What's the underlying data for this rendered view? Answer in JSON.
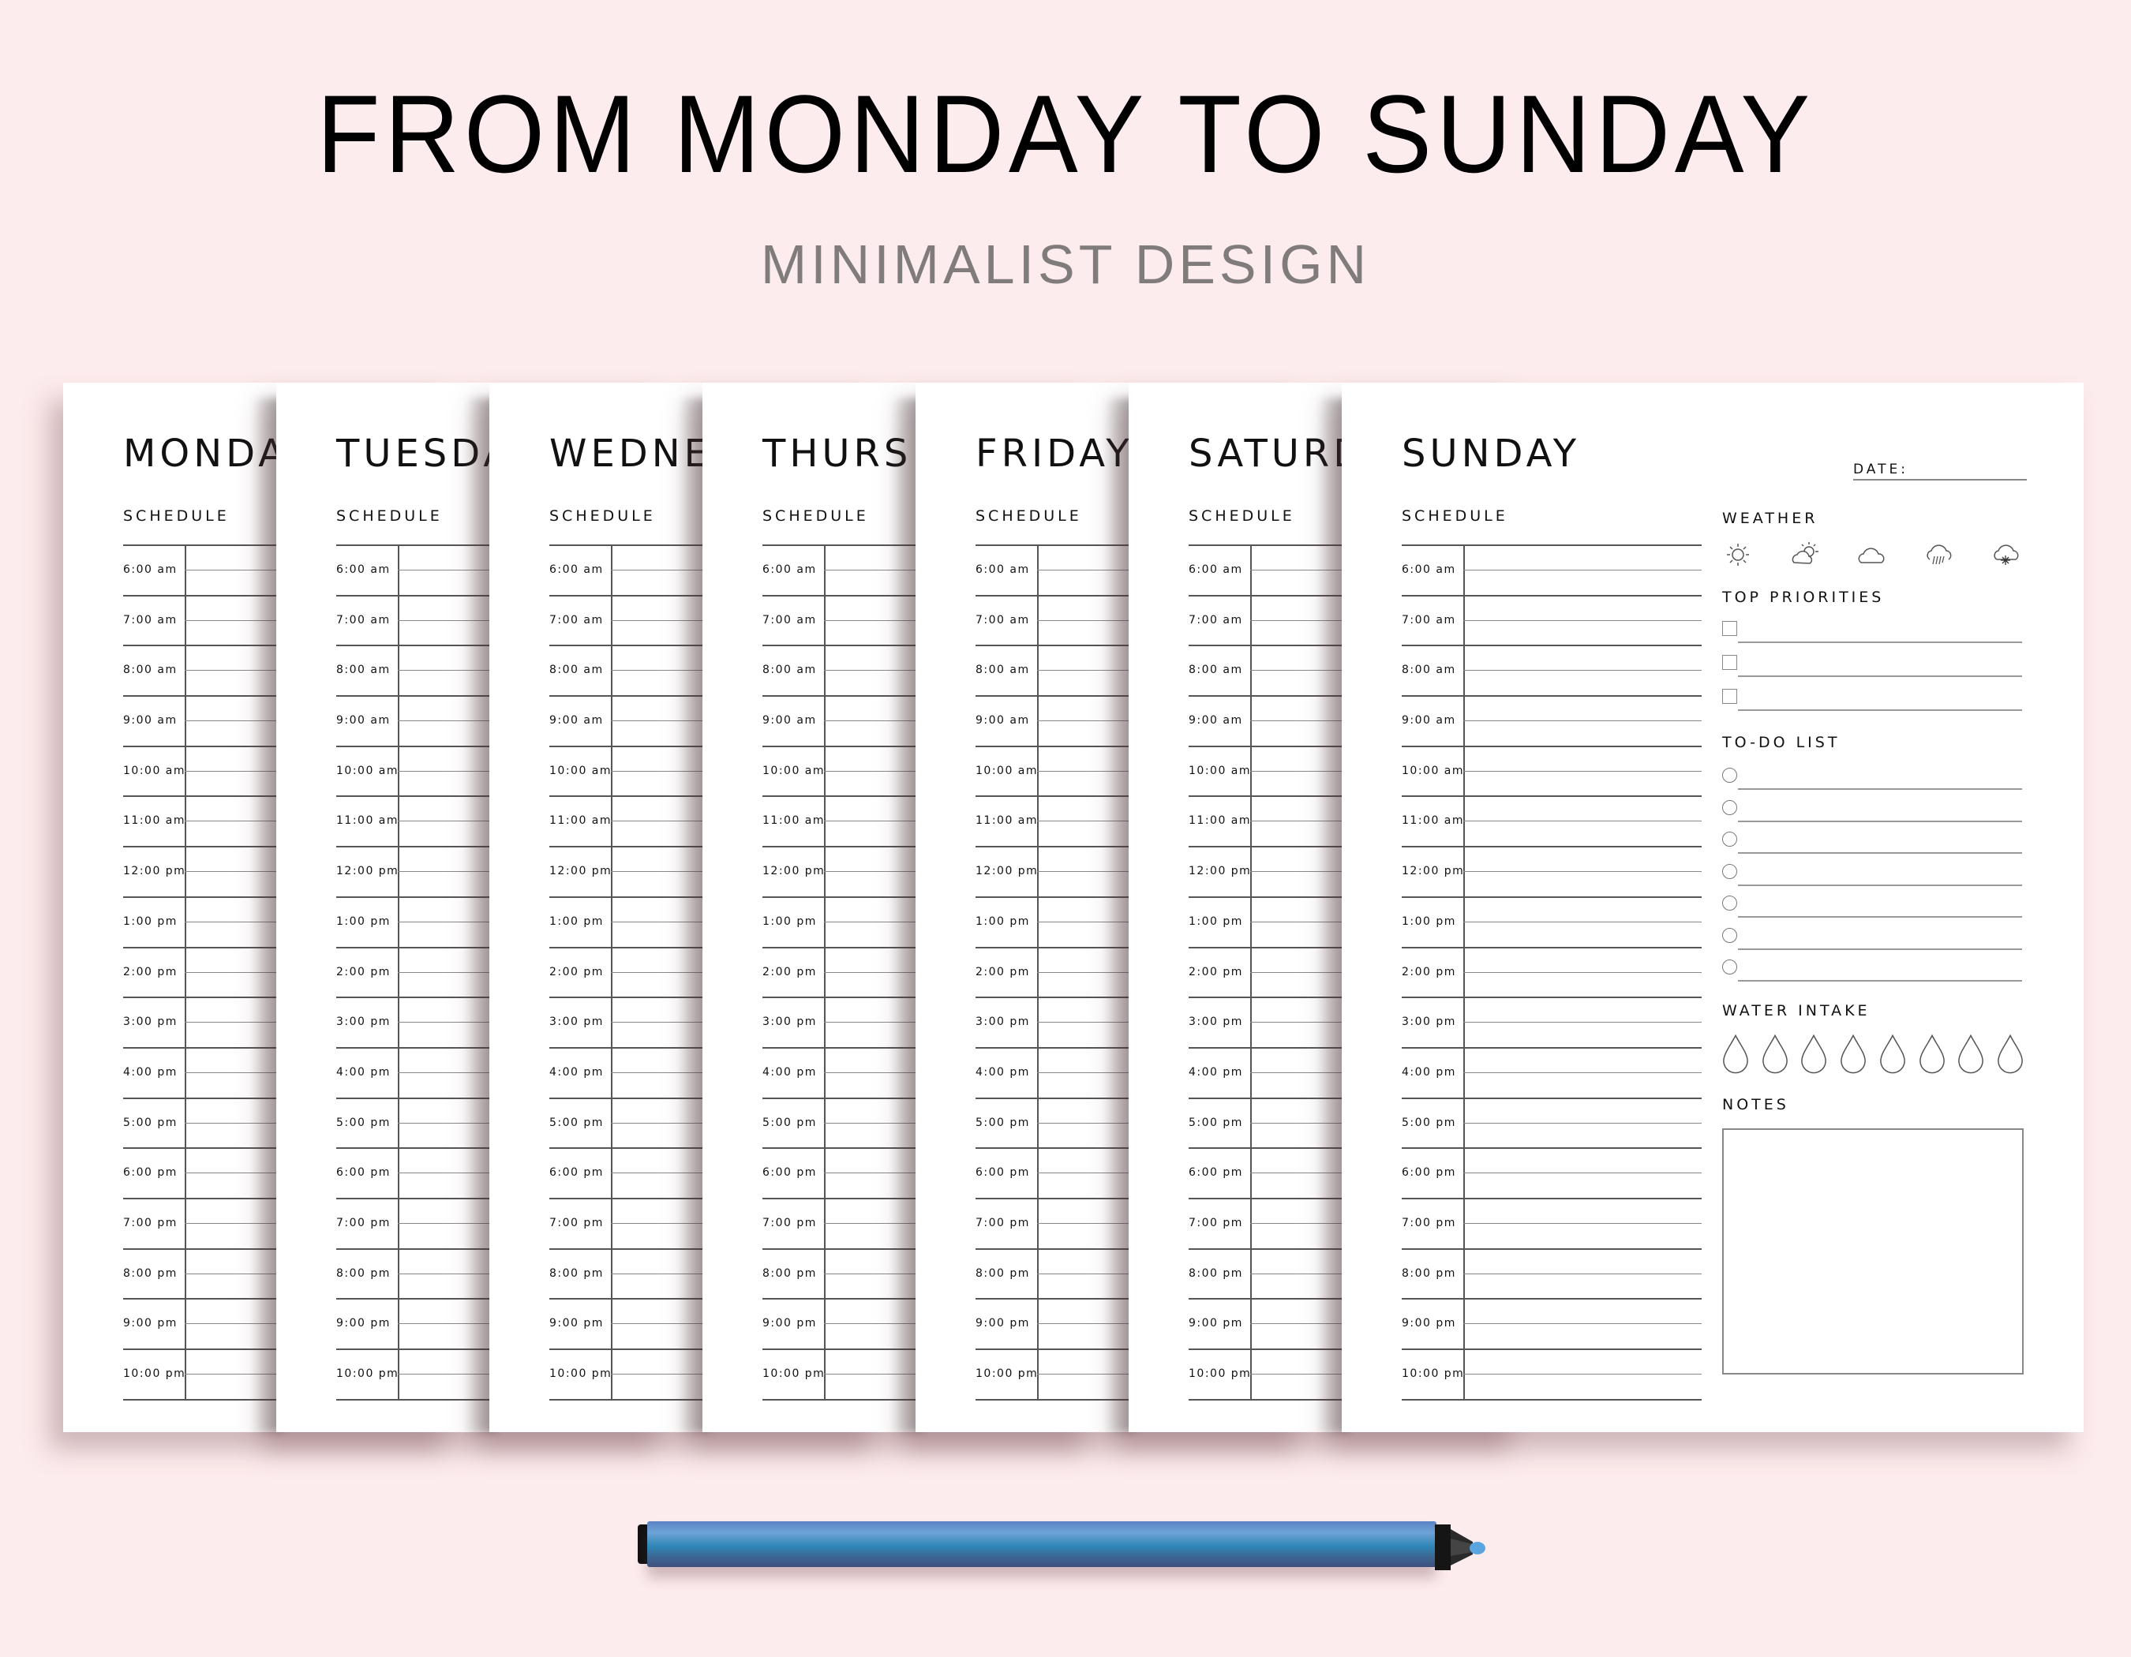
{
  "header": {
    "title": "FROM MONDAY TO SUNDAY",
    "subtitle": "MINIMALIST DESIGN"
  },
  "colors": {
    "background": "#fdeced",
    "page": "#ffffff",
    "subtitle": "#807c7c",
    "pen_body": "#4a86c0"
  },
  "planner": {
    "schedule_label": "SCHEDULE",
    "times": [
      "6:00 am",
      "7:00 am",
      "8:00 am",
      "9:00 am",
      "10:00 am",
      "11:00 am",
      "12:00 pm",
      "1:00 pm",
      "2:00 pm",
      "3:00 pm",
      "4:00 pm",
      "5:00 pm",
      "6:00 pm",
      "7:00 pm",
      "8:00 pm",
      "9:00 pm",
      "10:00 pm"
    ],
    "days": [
      {
        "name": "MONDAY",
        "visible_name": "MONDAY"
      },
      {
        "name": "TUESDAY",
        "visible_name": "TUESDAY"
      },
      {
        "name": "WEDNESDAY",
        "visible_name": "WEDNES"
      },
      {
        "name": "THURSDAY",
        "visible_name": "THURSDA"
      },
      {
        "name": "FRIDAY",
        "visible_name": "FRIDAY"
      },
      {
        "name": "SATURDAY",
        "visible_name": "SATURDA"
      },
      {
        "name": "SUNDAY",
        "visible_name": "SUNDAY"
      }
    ],
    "sidebar": {
      "date_label": "DATE:",
      "weather_label": "WEATHER",
      "weather_icons": [
        "sun-icon",
        "partly-cloudy-icon",
        "cloud-icon",
        "rain-icon",
        "snow-icon"
      ],
      "top_priorities_label": "TOP PRIORITIES",
      "top_priorities_count": 3,
      "todo_label": "TO-DO LIST",
      "todo_count": 7,
      "water_label": "WATER INTAKE",
      "water_drops": 8,
      "notes_label": "NOTES"
    }
  }
}
